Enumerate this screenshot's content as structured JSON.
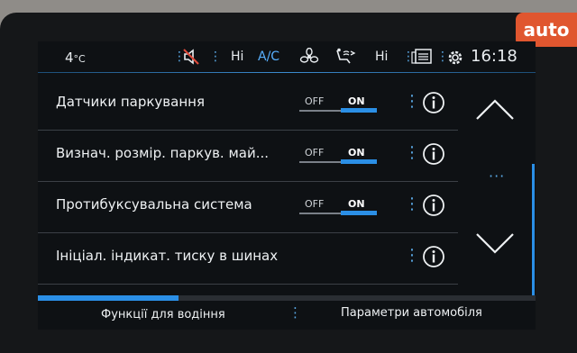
{
  "watermark": {
    "text": "auto"
  },
  "status_bar": {
    "temperature": "4",
    "temperature_unit": "°C",
    "fan_left": "Hi",
    "ac_label": "A/C",
    "fan_right": "Hi",
    "clock": "16:18",
    "dot_separator": "⋮"
  },
  "settings": {
    "rows": [
      {
        "label": "Датчики паркування",
        "off_label": "OFF",
        "on_label": "ON",
        "state": "ON"
      },
      {
        "label": "Визнач. розмір. паркув. май...",
        "off_label": "OFF",
        "on_label": "ON",
        "state": "ON"
      },
      {
        "label": "Протибуксувальна система",
        "off_label": "OFF",
        "on_label": "ON",
        "state": "ON"
      },
      {
        "label": "Ініціал. індикат. тиску в шинах"
      }
    ],
    "menu_glyph": "⋮",
    "more_glyph": "···"
  },
  "bottom_bar": {
    "progress_fraction": 0.5,
    "tab_driver": "Функції для водіння",
    "tab_vehicle": "Параметри автомобіля",
    "separator": "⋮"
  },
  "colors": {
    "accent": "#2b8fe6",
    "background": "#0e1114",
    "text": "#eef1f3"
  }
}
